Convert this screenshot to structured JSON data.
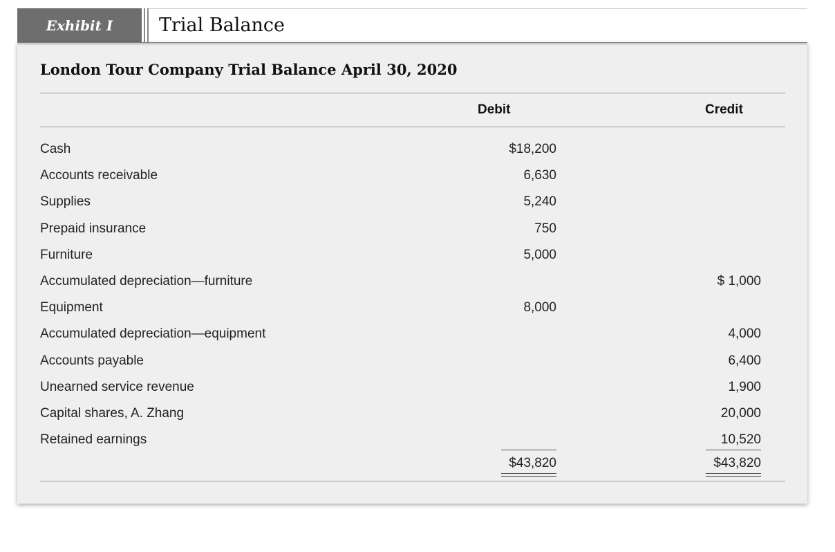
{
  "exhibit": {
    "label": "Exhibit I",
    "title": "Trial Balance"
  },
  "table": {
    "title": "London Tour Company Trial Balance April 30, 2020",
    "columns": {
      "debit": "Debit",
      "credit": "Credit"
    },
    "rows": [
      {
        "account": "Cash",
        "debit": "$18,200",
        "credit": ""
      },
      {
        "account": "Accounts receivable",
        "debit": "6,630",
        "credit": ""
      },
      {
        "account": "Supplies",
        "debit": "5,240",
        "credit": ""
      },
      {
        "account": "Prepaid insurance",
        "debit": "750",
        "credit": ""
      },
      {
        "account": "Furniture",
        "debit": "5,000",
        "credit": ""
      },
      {
        "account": "Accumulated depreciation—furniture",
        "debit": "",
        "credit": "$ 1,000"
      },
      {
        "account": "Equipment",
        "debit": "8,000",
        "credit": ""
      },
      {
        "account": "Accumulated depreciation—equipment",
        "debit": "",
        "credit": "4,000"
      },
      {
        "account": "Accounts payable",
        "debit": "",
        "credit": "6,400"
      },
      {
        "account": "Unearned service revenue",
        "debit": "",
        "credit": "1,900"
      },
      {
        "account": "Capital shares, A. Zhang",
        "debit": "",
        "credit": "20,000"
      },
      {
        "account": "Retained earnings",
        "debit": "",
        "credit": "10,520"
      }
    ],
    "totals": {
      "debit": "$43,820",
      "credit": "$43,820"
    }
  }
}
